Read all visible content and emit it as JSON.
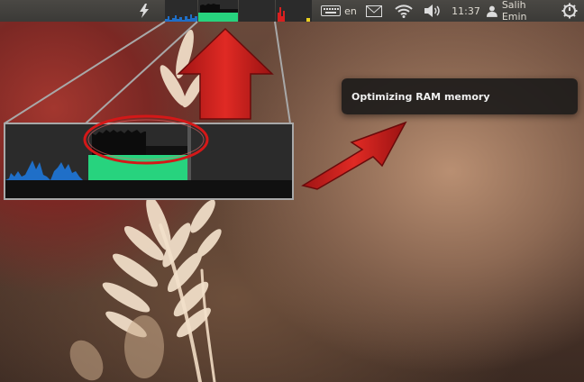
{
  "panel": {
    "keyboard_layout": "en",
    "clock": "11:37",
    "user_name": "Salih Emin"
  },
  "icons": {
    "power_manager": "lightning-bolt-icon",
    "keyboard": "keyboard-icon",
    "mail": "envelope-icon",
    "wifi": "wifi-icon",
    "volume": "speaker-icon",
    "user": "person-icon",
    "session": "power-gear-icon"
  },
  "system_monitor": {
    "colors": {
      "cpu": "#1f6fc8",
      "memory": "#27d37e",
      "network": "#d92020",
      "background": "#2b2b2b"
    }
  },
  "notification": {
    "message": "Optimizing RAM memory"
  },
  "annotation": {
    "arrow_color": "#c8201c",
    "circle_color": "#d41818"
  }
}
